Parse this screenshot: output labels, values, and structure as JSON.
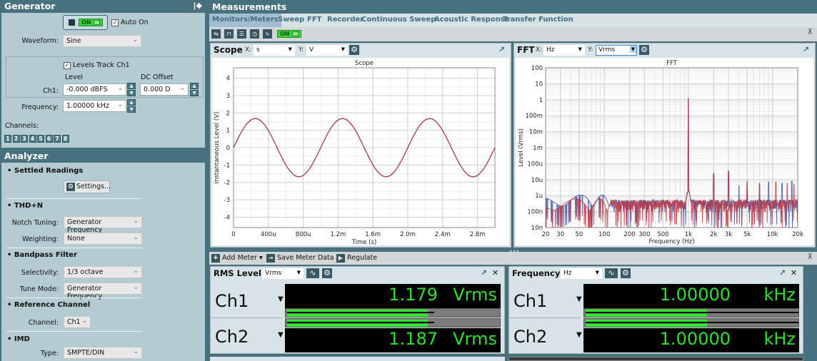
{
  "generator": {
    "title": "Generator",
    "pin_icon": "pin-icon",
    "output_button": {
      "state": "ON"
    },
    "auto_on": {
      "label": "Auto On",
      "checked": true
    },
    "waveform": {
      "label": "Waveform:",
      "value": "Sine"
    },
    "levels_track": {
      "label": "Levels Track Ch1",
      "checked": true
    },
    "level_header": "Level",
    "dc_offset_header": "DC Offset",
    "ch1_label": "Ch1:",
    "ch1_level": "-0.000 dBFS",
    "ch1_dc_offset": "0.000 D",
    "frequency": {
      "label": "Frequency:",
      "value": "1.00000 kHz"
    },
    "channels_label": "Channels:",
    "channels": [
      "1",
      "2",
      "3",
      "4",
      "5",
      "6",
      "7",
      "8"
    ]
  },
  "analyzer": {
    "title": "Analyzer",
    "settled_readings": {
      "header": "Settled Readings",
      "settings_button": "Settings..."
    },
    "thdn": {
      "header": "THD+N",
      "notch_label": "Notch Tuning:",
      "notch_value": "Generator Frequency",
      "weighting_label": "Weighting:",
      "weighting_value": "None"
    },
    "bandpass": {
      "header": "Bandpass Filter",
      "selectivity_label": "Selectivity:",
      "selectivity_value": "1/3 octave",
      "tune_label": "Tune Mode:",
      "tune_value": "Generator Frequency"
    },
    "reference": {
      "header": "Reference Channel",
      "channel_label": "Channel:",
      "channel_value": "Ch1"
    },
    "imd": {
      "header": "IMD",
      "type_label": "Type:",
      "type_value": "SMPTE/DIN"
    }
  },
  "measurements": {
    "title": "Measurements",
    "tabs": [
      "Monitors/Meters",
      "Sweep",
      "FFT",
      "Recorder",
      "Continuous Sweep",
      "Acoustic Response",
      "Transfer Function"
    ],
    "active_tab": "Monitors/Meters",
    "toolbar_on": "ON"
  },
  "scope": {
    "title": "Scope",
    "x_label": "X:",
    "x_unit": "s",
    "y_label": "Y:",
    "y_unit": "V"
  },
  "fft": {
    "title": "FFT",
    "x_label": "X:",
    "x_unit": "Hz",
    "y_label": "Y:",
    "y_unit": "Vrms"
  },
  "chart_data": [
    {
      "type": "line",
      "title": "Scope",
      "xlabel": "Time (s)",
      "ylabel": "Instantaneous Level (V)",
      "xlim": [
        0,
        0.003
      ],
      "ylim": [
        -4.6,
        4.6
      ],
      "x_ticks": [
        "0",
        "400u",
        "800u",
        "1.2m",
        "1.6m",
        "2.0m",
        "2.4m",
        "2.8m"
      ],
      "x_tick_values": [
        0,
        0.0004,
        0.0008,
        0.0012,
        0.0016,
        0.002,
        0.0024,
        0.0028
      ],
      "y_ticks": [
        "4",
        "3",
        "2",
        "1",
        "0",
        "-1",
        "-2",
        "-3",
        "-4"
      ],
      "y_tick_values": [
        4,
        3,
        2,
        1,
        0,
        -1,
        -2,
        -3,
        -4
      ],
      "grid": true,
      "series": [
        {
          "name": "Ch1",
          "color": "#3050a0",
          "amplitude": 1.67,
          "frequency_hz": 1000,
          "phase_deg": 0
        },
        {
          "name": "Ch2",
          "color": "#c0303a",
          "amplitude": 1.68,
          "frequency_hz": 1000,
          "phase_deg": 0
        }
      ]
    },
    {
      "type": "line",
      "title": "FFT",
      "xlabel": "Frequency (Hz)",
      "ylabel": "Level (Vrms)",
      "xscale": "log",
      "yscale": "log",
      "xlim": [
        20,
        20000
      ],
      "ylim": [
        1e-08,
        100
      ],
      "x_ticks": [
        "20",
        "30",
        "50",
        "100",
        "200",
        "300",
        "500",
        "1k",
        "2k",
        "3k",
        "5k",
        "10k",
        "20k"
      ],
      "x_tick_values": [
        20,
        30,
        50,
        100,
        200,
        300,
        500,
        1000,
        2000,
        3000,
        5000,
        10000,
        20000
      ],
      "y_ticks": [
        "100",
        "10",
        "1",
        "100m",
        "10m",
        "1m",
        "100u",
        "10u",
        "1u",
        "100n",
        "10n"
      ],
      "y_tick_values": [
        100,
        10,
        1,
        0.1,
        0.01,
        0.001,
        0.0001,
        1e-05,
        1e-06,
        1e-07,
        1e-08
      ],
      "grid": true,
      "noise_floor": 3e-07,
      "series": [
        {
          "name": "Ch1",
          "color": "#3a4f98",
          "peaks": [
            [
              1000,
              1.18
            ],
            [
              2000,
              2e-05
            ],
            [
              3000,
              3e-05
            ],
            [
              4000,
              4e-06
            ],
            [
              5000,
              8e-06
            ],
            [
              7000,
              6e-06
            ],
            [
              9000,
              7e-06
            ],
            [
              13000,
              6e-06
            ],
            [
              17000,
              8e-06
            ]
          ]
        },
        {
          "name": "Ch2",
          "color": "#c2303c",
          "peaks": [
            [
              1000,
              1.19
            ],
            [
              2000,
              2.5e-05
            ],
            [
              3000,
              3.5e-05
            ],
            [
              5000,
              6e-06
            ],
            [
              7000,
              5e-06
            ],
            [
              11000,
              7e-06
            ],
            [
              15000,
              6e-06
            ],
            [
              18000,
              5e-06
            ]
          ]
        }
      ]
    }
  ],
  "meter_toolbar": {
    "add_meter": "Add Meter",
    "save_meter_data": "Save Meter Data",
    "regulate": "Regulate"
  },
  "rms_meter": {
    "title": "RMS Level",
    "unit_select": "Vrms",
    "channels": [
      {
        "name": "Ch1",
        "value": "1.179",
        "unit": "Vrms",
        "bar_fraction": 0.66,
        "peak_fraction": 0.69
      },
      {
        "name": "Ch2",
        "value": "1.187",
        "unit": "Vrms",
        "bar_fraction": 0.66,
        "peak_fraction": 0.69
      }
    ]
  },
  "freq_meter": {
    "title": "Frequency",
    "unit_select": "Hz",
    "channels": [
      {
        "name": "Ch1",
        "value": "1.00000",
        "unit": "kHz",
        "bar_fraction": 0.57,
        "peak_fraction": 1.0
      },
      {
        "name": "Ch2",
        "value": "1.00000",
        "unit": "kHz",
        "bar_fraction": 0.57,
        "peak_fraction": 1.0
      }
    ]
  }
}
